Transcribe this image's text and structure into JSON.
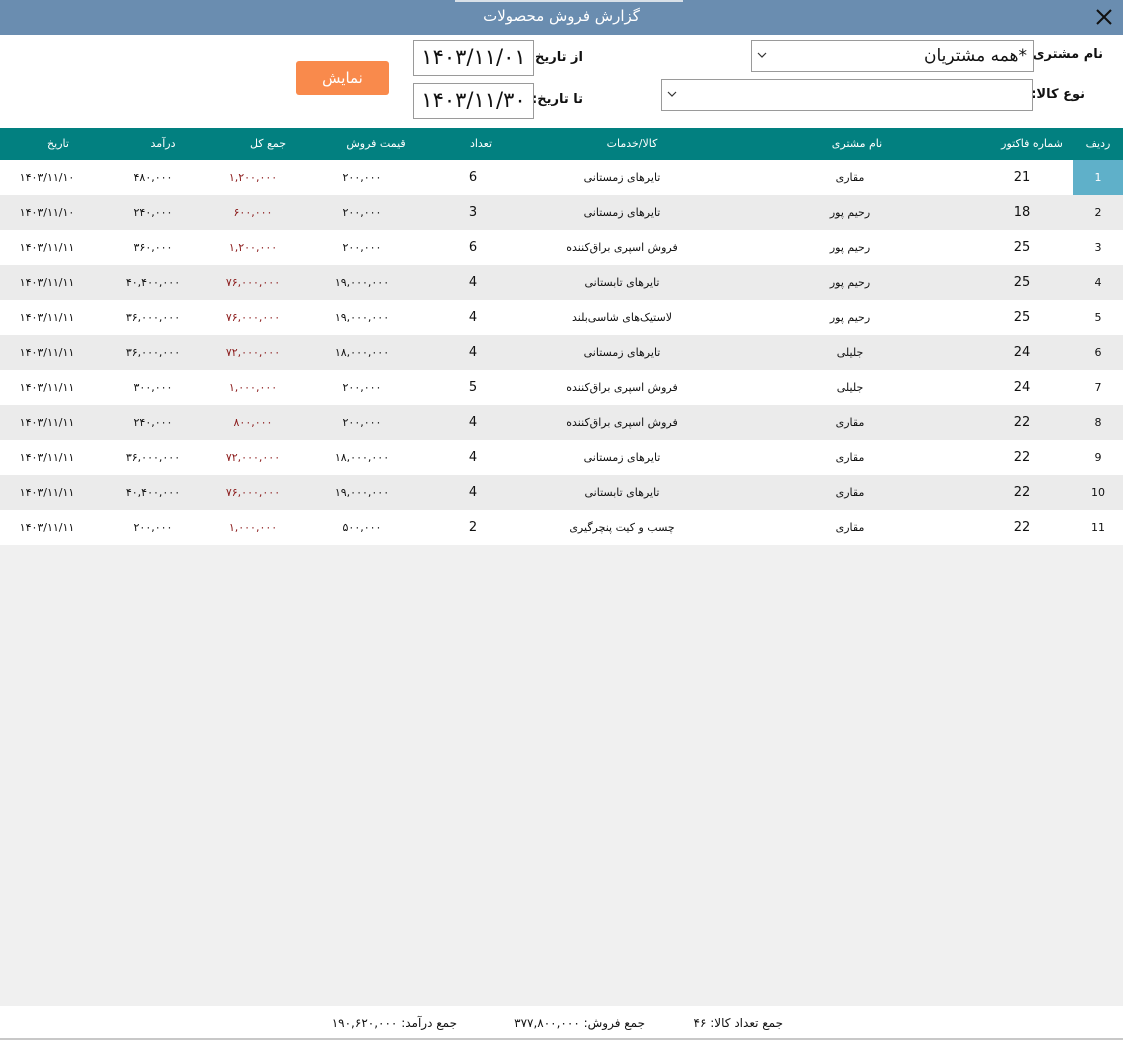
{
  "window": {
    "title": "گزارش فروش محصولات",
    "close_icon": "close-icon"
  },
  "filters": {
    "customer_label": "نام مشتری:",
    "customer_value": "*همه مشتریان",
    "product_type_label": "نوع کالا:",
    "product_type_value": "",
    "from_date_label": "از تاریخ:",
    "from_date_value": "۱۴۰۳/۱۱/۰۱",
    "to_date_label": "تا تاریخ:",
    "to_date_value": "۱۴۰۳/۱۱/۳۰",
    "show_button": "نمایش"
  },
  "table": {
    "columns": {
      "row": "ردیف",
      "invoice": "شماره فاکتور",
      "customer": "نام مشتری",
      "product": "کالا/خدمات",
      "qty": "تعداد",
      "price": "قیمت فروش",
      "total": "جمع کل",
      "income": "درآمد",
      "date": "تاریخ"
    },
    "rows": [
      {
        "row": "1",
        "invoice": "21",
        "customer": "مقاری",
        "product": "تایرهای زمستانی",
        "qty": "6",
        "price": "۲۰۰,۰۰۰",
        "total": "۱,۲۰۰,۰۰۰",
        "income": "۴۸۰,۰۰۰",
        "date": "۱۴۰۳/۱۱/۱۰"
      },
      {
        "row": "2",
        "invoice": "18",
        "customer": "رحیم پور",
        "product": "تایرهای زمستانی",
        "qty": "3",
        "price": "۲۰۰,۰۰۰",
        "total": "۶۰۰,۰۰۰",
        "income": "۲۴۰,۰۰۰",
        "date": "۱۴۰۳/۱۱/۱۰"
      },
      {
        "row": "3",
        "invoice": "25",
        "customer": "رحیم پور",
        "product": "فروش اسپری براق‌کننده",
        "qty": "6",
        "price": "۲۰۰,۰۰۰",
        "total": "۱,۲۰۰,۰۰۰",
        "income": "۳۶۰,۰۰۰",
        "date": "۱۴۰۳/۱۱/۱۱"
      },
      {
        "row": "4",
        "invoice": "25",
        "customer": "رحیم پور",
        "product": "تایرهای تابستانی",
        "qty": "4",
        "price": "۱۹,۰۰۰,۰۰۰",
        "total": "۷۶,۰۰۰,۰۰۰",
        "income": "۴۰,۴۰۰,۰۰۰",
        "date": "۱۴۰۳/۱۱/۱۱"
      },
      {
        "row": "5",
        "invoice": "25",
        "customer": "رحیم پور",
        "product": "لاستیک‌های شاسی‌بلند",
        "qty": "4",
        "price": "۱۹,۰۰۰,۰۰۰",
        "total": "۷۶,۰۰۰,۰۰۰",
        "income": "۳۶,۰۰۰,۰۰۰",
        "date": "۱۴۰۳/۱۱/۱۱"
      },
      {
        "row": "6",
        "invoice": "24",
        "customer": "جلیلی",
        "product": "تایرهای زمستانی",
        "qty": "4",
        "price": "۱۸,۰۰۰,۰۰۰",
        "total": "۷۲,۰۰۰,۰۰۰",
        "income": "۳۶,۰۰۰,۰۰۰",
        "date": "۱۴۰۳/۱۱/۱۱"
      },
      {
        "row": "7",
        "invoice": "24",
        "customer": "جلیلی",
        "product": "فروش اسپری براق‌کننده",
        "qty": "5",
        "price": "۲۰۰,۰۰۰",
        "total": "۱,۰۰۰,۰۰۰",
        "income": "۳۰۰,۰۰۰",
        "date": "۱۴۰۳/۱۱/۱۱"
      },
      {
        "row": "8",
        "invoice": "22",
        "customer": "مقاری",
        "product": "فروش اسپری براق‌کننده",
        "qty": "4",
        "price": "۲۰۰,۰۰۰",
        "total": "۸۰۰,۰۰۰",
        "income": "۲۴۰,۰۰۰",
        "date": "۱۴۰۳/۱۱/۱۱"
      },
      {
        "row": "9",
        "invoice": "22",
        "customer": "مقاری",
        "product": "تایرهای زمستانی",
        "qty": "4",
        "price": "۱۸,۰۰۰,۰۰۰",
        "total": "۷۲,۰۰۰,۰۰۰",
        "income": "۳۶,۰۰۰,۰۰۰",
        "date": "۱۴۰۳/۱۱/۱۱"
      },
      {
        "row": "10",
        "invoice": "22",
        "customer": "مقاری",
        "product": "تایرهای تابستانی",
        "qty": "4",
        "price": "۱۹,۰۰۰,۰۰۰",
        "total": "۷۶,۰۰۰,۰۰۰",
        "income": "۴۰,۴۰۰,۰۰۰",
        "date": "۱۴۰۳/۱۱/۱۱"
      },
      {
        "row": "11",
        "invoice": "22",
        "customer": "مقاری",
        "product": "چسب و کیت پنچرگیری",
        "qty": "2",
        "price": "۵۰۰,۰۰۰",
        "total": "۱,۰۰۰,۰۰۰",
        "income": "۲۰۰,۰۰۰",
        "date": "۱۴۰۳/۱۱/۱۱"
      }
    ],
    "selected_row": "1"
  },
  "footer": {
    "total_qty_label": "جمع تعداد کالا:",
    "total_qty_value": "۴۶",
    "total_sales_label": "جمع فروش:",
    "total_sales_value": "۳۷۷,۸۰۰,۰۰۰",
    "total_income_label": "جمع درآمد:",
    "total_income_value": "۱۹۰,۶۲۰,۰۰۰"
  },
  "colors": {
    "titlebar": "#6a8db0",
    "header": "#028080",
    "button": "#f98a4c",
    "selected": "#5fb0c9",
    "total_text": "#8b1a1a"
  }
}
